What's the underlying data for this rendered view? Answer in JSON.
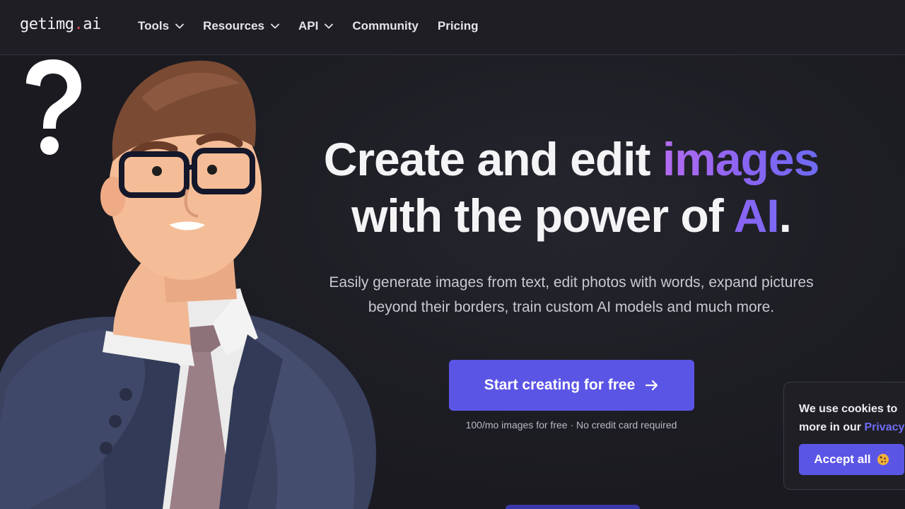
{
  "header": {
    "logo_text": "getimg",
    "logo_dot": ".",
    "logo_suffix": "ai",
    "nav": [
      {
        "label": "Tools",
        "has_dropdown": true
      },
      {
        "label": "Resources",
        "has_dropdown": true
      },
      {
        "label": "API",
        "has_dropdown": true
      },
      {
        "label": "Community",
        "has_dropdown": false
      },
      {
        "label": "Pricing",
        "has_dropdown": false
      }
    ]
  },
  "hero": {
    "title_part1": "Create and edit ",
    "title_highlight1": "images",
    "title_part2": "with the power of ",
    "title_highlight2": "AI",
    "title_end": ".",
    "subtitle_line1": "Easily generate images from text, edit photos with words, expand pictures",
    "subtitle_line2": "beyond their borders, train custom AI models and much more.",
    "cta_label": "Start creating for free",
    "cta_note": "100/mo images for free · No credit card required"
  },
  "cookie_banner": {
    "line1": "We use cookies to",
    "line2_prefix": "more in our ",
    "line2_link": "Privacy",
    "accept_label": "Accept all"
  },
  "illustration": {
    "icon": "question-mark-icon",
    "figure": "thinking-man-illustration"
  },
  "colors": {
    "background": "#1c1c22",
    "accent": "#5b55e6",
    "gradient_start": "#b46cf0",
    "gradient_end": "#6e6af3",
    "logo_dot": "#e0475c"
  }
}
